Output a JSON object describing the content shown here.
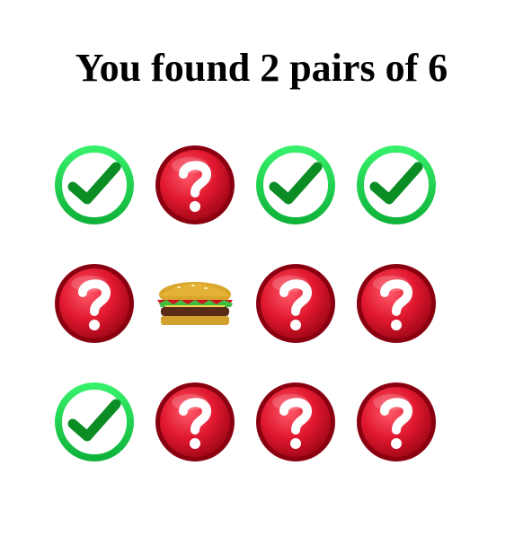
{
  "header": {
    "title": "You found 2 pairs of 6"
  },
  "board": {
    "columns": 4,
    "rows": 3,
    "cards": [
      {
        "state": "matched",
        "icon": "check-icon"
      },
      {
        "state": "hidden",
        "icon": "question-icon"
      },
      {
        "state": "matched",
        "icon": "check-icon"
      },
      {
        "state": "matched",
        "icon": "check-icon"
      },
      {
        "state": "hidden",
        "icon": "question-icon"
      },
      {
        "state": "revealed",
        "icon": "burger-icon"
      },
      {
        "state": "hidden",
        "icon": "question-icon"
      },
      {
        "state": "hidden",
        "icon": "question-icon"
      },
      {
        "state": "matched",
        "icon": "check-icon"
      },
      {
        "state": "hidden",
        "icon": "question-icon"
      },
      {
        "state": "hidden",
        "icon": "question-icon"
      },
      {
        "state": "hidden",
        "icon": "question-icon"
      }
    ]
  },
  "colors": {
    "check_ring": "#17d34a",
    "check_mark": "#0c8a22",
    "question_red": "#d4142b",
    "question_dark": "#8a0010"
  }
}
